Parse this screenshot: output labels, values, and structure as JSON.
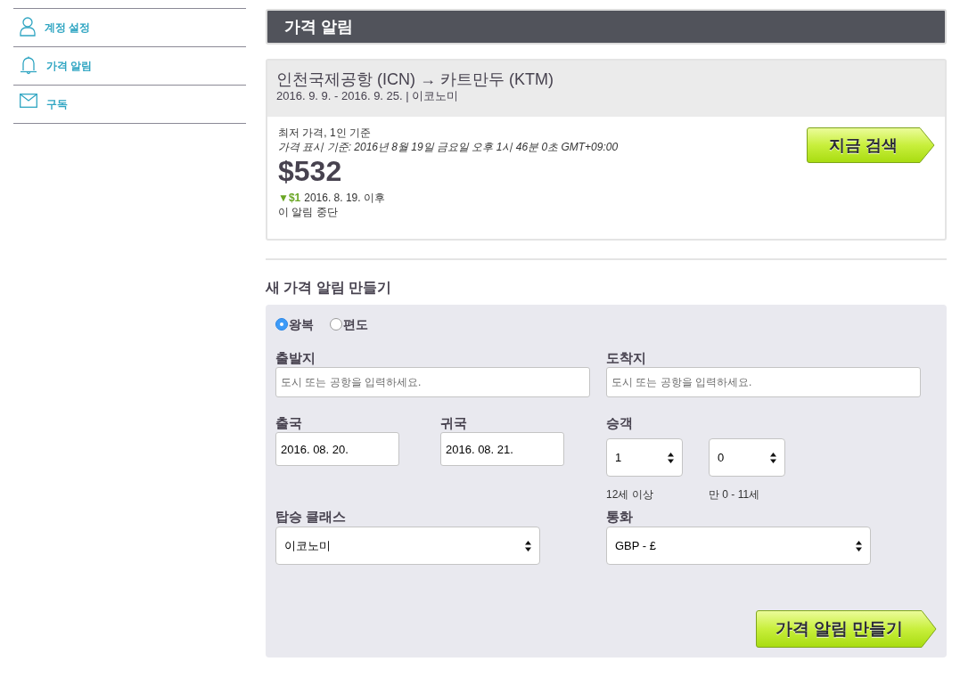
{
  "sidebar": {
    "items": [
      {
        "label": "계정 설정"
      },
      {
        "label": "가격 알림"
      },
      {
        "label": "구독"
      }
    ]
  },
  "page_header": {
    "title": "가격 알림"
  },
  "alerts": [
    {
      "route": "인천국제공항 (ICN) → 카트만두 (KTM)",
      "details": "2016. 9. 9. - 2016. 9. 25. | 이코노미",
      "price_basis": "최저 가격, 1인 기준",
      "price_timestamp": "가격 표시 기준: 2016년 8월 19일 금요일 오후 1시 46분 0초 GMT+09:00",
      "price": "$532",
      "price_change": "▼$1",
      "price_change_note": "2016. 8. 19. 이후",
      "stop_link": "이 알림 중단",
      "search_button": "지금 검색"
    }
  ],
  "new_alert": {
    "heading": "새 가격 알림 만들기",
    "trip_types": [
      {
        "label": "왕복",
        "selected": true
      },
      {
        "label": "편도",
        "selected": false
      }
    ],
    "origin": {
      "label": "출발지",
      "placeholder": "도시 또는 공항을 입력하세요."
    },
    "destination": {
      "label": "도착지",
      "placeholder": "도시 또는 공항을 입력하세요."
    },
    "departure": {
      "label": "출국",
      "value": "2016. 08. 20."
    },
    "return": {
      "label": "귀국",
      "value": "2016. 08. 21."
    },
    "passengers": {
      "label": "승객",
      "fields": [
        {
          "value": "1",
          "note": "12세 이상"
        },
        {
          "value": "0",
          "note": "만 0 - 11세"
        }
      ]
    },
    "cabin_class": {
      "label": "탑승 클래스",
      "value": "이코노미"
    },
    "currency": {
      "label": "통화",
      "value": "GBP - £"
    },
    "submit_button": "가격 알림 만들기"
  }
}
